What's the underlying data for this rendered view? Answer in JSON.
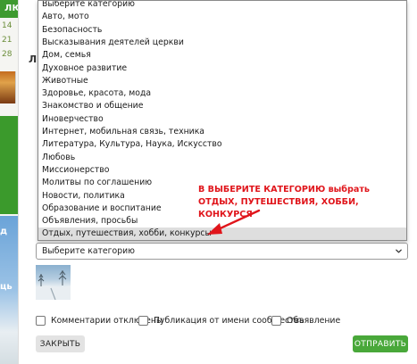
{
  "topbar": {
    "nav_label": "ЛЮДИ"
  },
  "left_column": {
    "calendar_days": [
      "14",
      "21",
      "28"
    ],
    "photo_text_1": "д",
    "photo_text_2": "ць"
  },
  "modal": {
    "side_letter": "Л",
    "dropdown": {
      "options": [
        "Выберите категорию",
        "Авто, мото",
        "Безопасность",
        "Высказывания деятелей церкви",
        "Дом, семья",
        "Духовное развитие",
        "Животные",
        "Здоровье, красота, мода",
        "Знакомство и общение",
        "Иноверчество",
        "Интернет, мобильная связь, техника",
        "Литература, Культура, Наука, Искусство",
        "Любовь",
        "Миссионерство",
        "Молитвы по соглашению",
        "Новости, политика",
        "Образование и воспитание",
        "Объявления, просьбы",
        "Отдых, путешествия, хобби, конкурсы"
      ],
      "highlighted_index": 18
    },
    "select": {
      "value": "Выберите категорию"
    },
    "checkboxes": [
      {
        "label": "Комментарии отключены",
        "checked": false
      },
      {
        "label": "Публикация от имени сообщества",
        "checked": false
      },
      {
        "label": "Объявление",
        "checked": false
      }
    ],
    "buttons": {
      "close": "ЗАКРЫТЬ",
      "send": "ОТПРАВИТЬ"
    },
    "annotation": {
      "line1": "В ВЫБЕРИТЕ КАТЕГОРИЮ выбрать",
      "line2": "ОТДЫХ, ПУТЕШЕСТВИЯ, ХОББИ, КОНКУРСЯ",
      "color": "#e0151b"
    }
  },
  "colors": {
    "brand_green": "#3e9a2f",
    "send_button": "#49a83a"
  },
  "icons": [
    "chevron-down-icon",
    "arrow-annotation-icon"
  ]
}
